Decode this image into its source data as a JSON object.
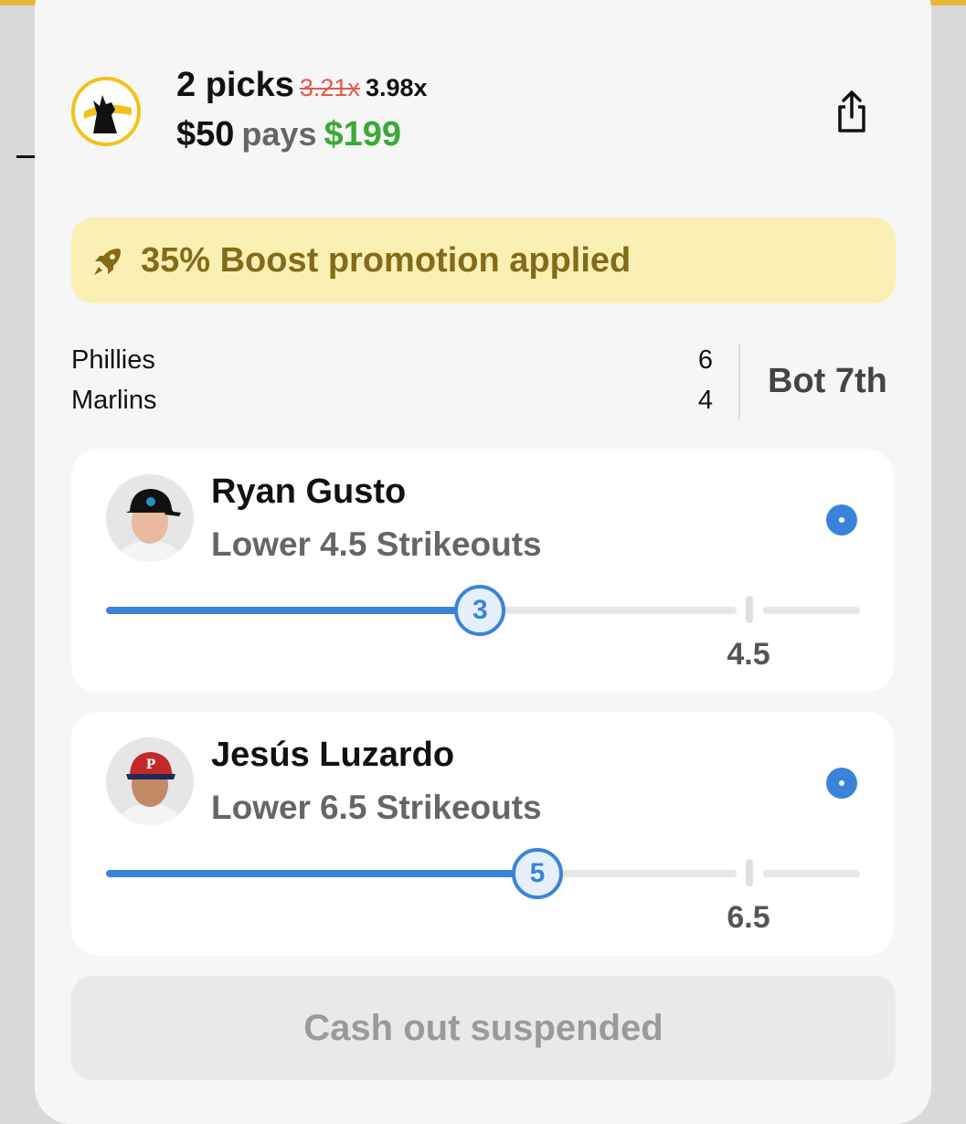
{
  "header": {
    "picks_label": "2 picks",
    "original_multiplier": "3.21x",
    "boosted_multiplier": "3.98x",
    "stake": "$50",
    "pays_label": "pays",
    "payout": "$199"
  },
  "promo": {
    "icon": "rocket-icon",
    "text": "35% Boost promotion applied"
  },
  "game": {
    "teams": [
      {
        "name": "Phillies",
        "score": "6"
      },
      {
        "name": "Marlins",
        "score": "4"
      }
    ],
    "inning": "Bot 7th"
  },
  "picks": [
    {
      "player": "Ryan Gusto",
      "direction": "Lower",
      "line_text": "4.5 Strikeouts",
      "current": "3",
      "line_value": "4.5",
      "progress": 0.667,
      "status": "live"
    },
    {
      "player": "Jesús Luzardo",
      "direction": "Lower",
      "line_text": "6.5 Strikeouts",
      "current": "5",
      "line_value": "6.5",
      "progress": 0.769,
      "status": "live"
    }
  ],
  "cashout": {
    "label": "Cash out suspended"
  },
  "colors": {
    "accent_blue": "#3b82db",
    "payout_green": "#3ba935",
    "promo_bg": "#fbf0b3",
    "promo_text": "#846a1a",
    "strike_red": "#e05a4e"
  }
}
